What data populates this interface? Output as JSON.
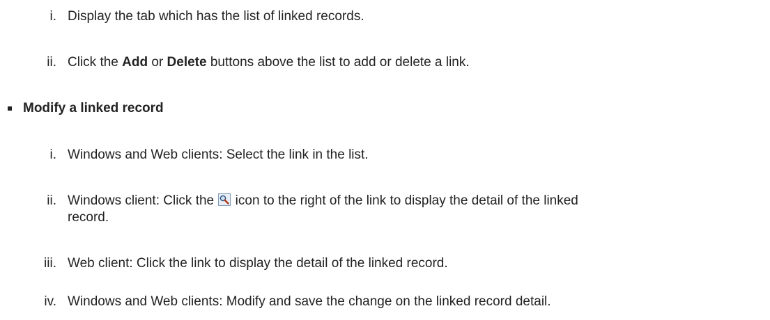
{
  "list1": {
    "items": [
      {
        "marker": "i.",
        "text": "Display the tab which has the list of linked records."
      },
      {
        "marker": "ii.",
        "text_before": "Click the ",
        "bold1": "Add",
        "text_middle": " or ",
        "bold2": "Delete",
        "text_after": " buttons above the list to add or delete a link."
      }
    ]
  },
  "section": {
    "heading": "Modify a linked record"
  },
  "list2": {
    "items": [
      {
        "marker": "i.",
        "text": "Windows and Web clients: Select the link in the list."
      },
      {
        "marker": "ii.",
        "text_before": "Windows client: Click the ",
        "icon": "magnifier-icon",
        "text_after": " icon to the right of the link to display the detail of the linked",
        "continuation": "record."
      },
      {
        "marker": "iii.",
        "text": "Web client: Click the link to display the detail of the linked record."
      },
      {
        "marker": "iv.",
        "text": "Windows and Web clients: Modify and save the change on the linked record detail."
      }
    ]
  }
}
